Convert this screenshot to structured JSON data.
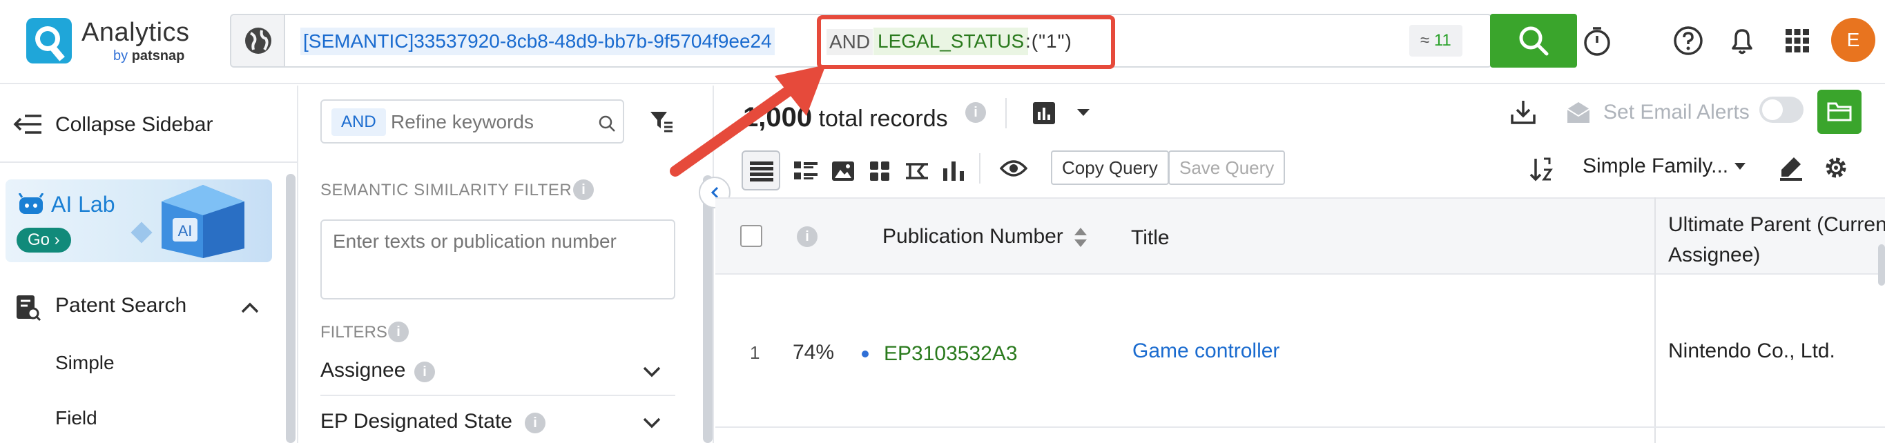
{
  "header": {
    "logo_title": "Analytics",
    "logo_by": "by",
    "logo_brand": "patsnap",
    "query": {
      "semantic": "[SEMANTIC]33537920-8cb8-48d9-bb7b-9f5704f9ee24",
      "and": "AND",
      "legal_field": "LEGAL_STATUS",
      "legal_value": ":(\"1\")"
    },
    "approx_prefix": "≈",
    "approx_count": "11",
    "avatar_letter": "E",
    "icons": [
      "timer-icon",
      "help-icon",
      "bell-icon",
      "apps-grid-icon"
    ]
  },
  "sidebar": {
    "collapse_label": "Collapse Sidebar",
    "ailab_title": "AI Lab",
    "ailab_go": "Go ›",
    "section_title": "Patent Search",
    "items": [
      {
        "label": "Simple"
      },
      {
        "label": "Field"
      }
    ]
  },
  "filters": {
    "and_chip": "AND",
    "refine_placeholder": "Refine keywords",
    "semantic_title": "SEMANTIC SIMILARITY FILTER",
    "semantic_placeholder": "Enter texts or publication number",
    "filters_title": "FILTERS",
    "groups": [
      {
        "label": "Assignee"
      },
      {
        "label": "EP Designated State"
      }
    ]
  },
  "results": {
    "total_count": "1,000",
    "total_label": "total records",
    "copy_query": "Copy Query",
    "save_query": "Save Query",
    "set_email_alerts": "Set Email Alerts",
    "family_select": "Simple Family...",
    "columns": {
      "publication_number": "Publication Number",
      "title": "Title",
      "ultimate_parent": "Ultimate Parent (Current Assignee)"
    },
    "rows": [
      {
        "index": "1",
        "score": "74%",
        "publication_number": "EP3103532A3",
        "title": "Game controller",
        "ultimate_parent": "Nintendo Co., Ltd."
      }
    ]
  },
  "colors": {
    "brand_green": "#3aa52c",
    "link_blue": "#1a6bcf",
    "highlight_red": "#e64a3b",
    "avatar_orange": "#e8741f"
  }
}
